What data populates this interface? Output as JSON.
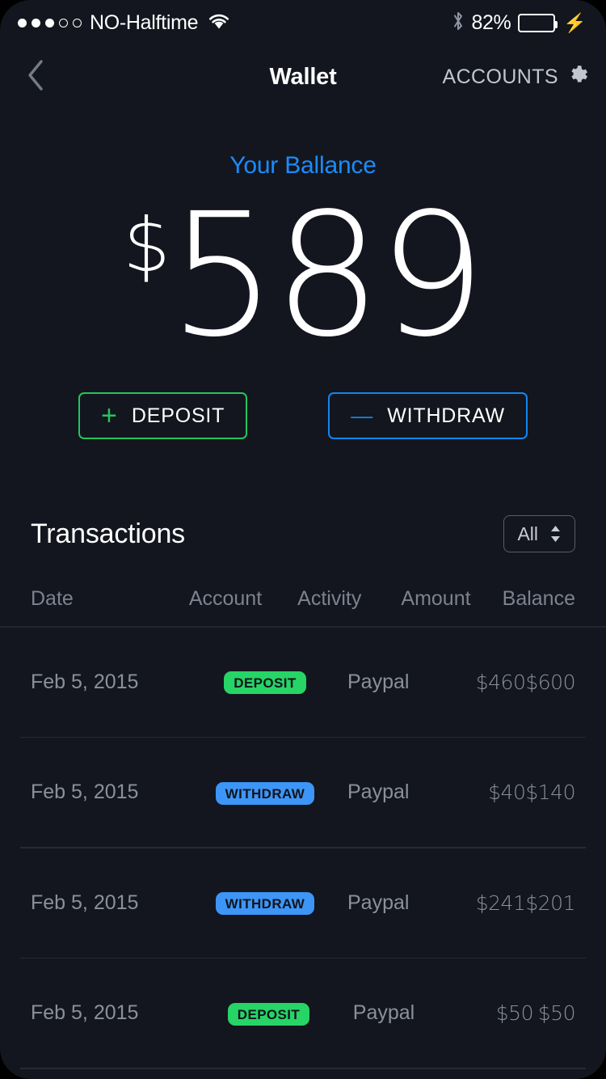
{
  "statusbar": {
    "signal_dots": [
      "filled",
      "filled",
      "filled",
      "hollow",
      "hollow"
    ],
    "carrier": "NO-Halftime",
    "wifi_icon": "wifi-icon",
    "bluetooth_icon": "bluetooth-icon",
    "battery_percent": "82%",
    "battery_level": 82,
    "charging_icon": "lightning-bolt-icon"
  },
  "navbar": {
    "back_icon": "chevron-left-icon",
    "title": "Wallet",
    "right_label": "ACCOUNTS",
    "gear_icon": "gear-icon"
  },
  "balance": {
    "label": "Your Ballance",
    "currency": "$",
    "value": "589"
  },
  "actions": {
    "deposit": {
      "symbol": "+",
      "label": "DEPOSIT",
      "color": "#24c45e"
    },
    "withdraw": {
      "symbol": "—",
      "label": "WITHDRAW",
      "color": "#1186f0"
    }
  },
  "transactions": {
    "title": "Transactions",
    "filter": {
      "value": "All",
      "stepper_icon": "stepper-updown-icon"
    },
    "columns": [
      "Date",
      "Account",
      "Activity",
      "Amount",
      "Balance"
    ],
    "rows": [
      {
        "date": "Feb 5, 2015",
        "account": "DEPOSIT",
        "account_type": "deposit",
        "activity": "Paypal",
        "amount": "$460",
        "balance": "$600"
      },
      {
        "date": "Feb 5, 2015",
        "account": "WITHDRAW",
        "account_type": "withdraw",
        "activity": "Paypal",
        "amount": "$40",
        "balance": "$140"
      },
      {
        "date": "Feb 5, 2015",
        "account": "WITHDRAW",
        "account_type": "withdraw",
        "activity": "Paypal",
        "amount": "$241",
        "balance": "$201"
      },
      {
        "date": "Feb 5, 2015",
        "account": "DEPOSIT",
        "account_type": "deposit",
        "activity": "Paypal",
        "amount": "$50",
        "balance": "$50"
      }
    ]
  },
  "colors": {
    "background": "#13161e",
    "accent_blue": "#1a8cff",
    "accent_green": "#24c45e",
    "badge_green": "#27d466",
    "badge_blue": "#3d96f7",
    "muted_text": "#8c909c"
  }
}
